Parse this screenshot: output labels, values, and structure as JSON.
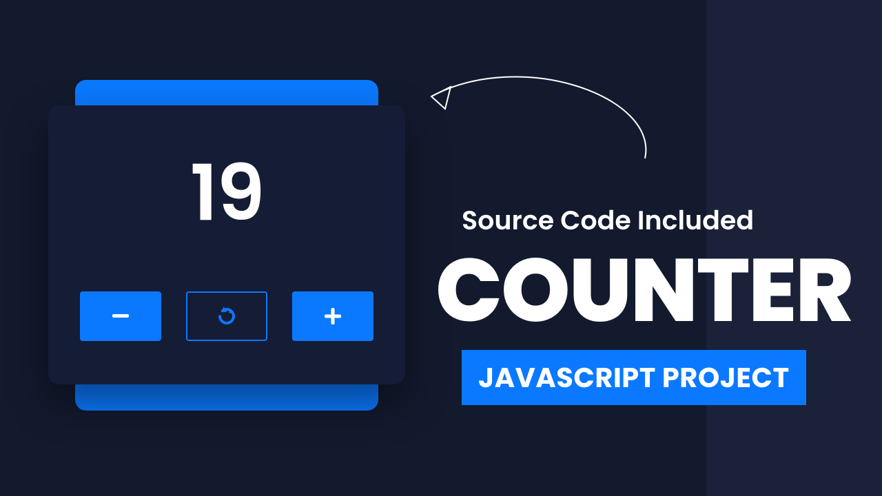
{
  "counter": {
    "value": "19"
  },
  "buttons": {
    "minus_label": "-",
    "reset_label": "reset",
    "plus_label": "+"
  },
  "text": {
    "tagline": "Source Code Included",
    "title": "COUNTER",
    "badge": "JAVASCRIPT PROJECT"
  },
  "colors": {
    "bg_main": "#131a2e",
    "bg_side": "#1a2138",
    "accent": "#0b79ff",
    "card": "#151c35",
    "text": "#ffffff"
  }
}
